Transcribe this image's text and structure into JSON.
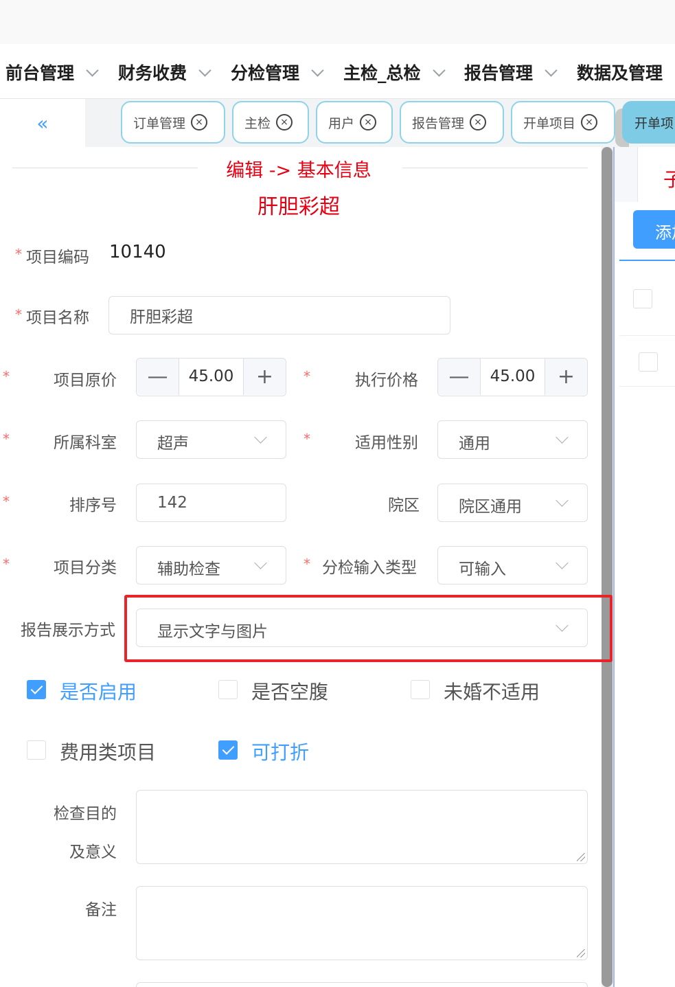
{
  "menu": [
    {
      "label": "前台管理"
    },
    {
      "label": "财务收费"
    },
    {
      "label": "分检管理"
    },
    {
      "label": "主检_总检"
    },
    {
      "label": "报告管理"
    },
    {
      "label": "数据及管理"
    }
  ],
  "tabs": [
    {
      "label": "订单管理"
    },
    {
      "label": "主检"
    },
    {
      "label": "用户"
    },
    {
      "label": "报告管理"
    },
    {
      "label": "开单项目"
    },
    {
      "label": "开单项"
    }
  ],
  "form": {
    "title": "编辑 -> 基本信息",
    "subtitle": "肝胆彩超",
    "code_label": "项目编码",
    "code_value": "10140",
    "name_label": "项目名称",
    "name_value": "肝胆彩超",
    "orig_price_label": "项目原价",
    "orig_price_value": "45.00",
    "exec_price_label": "执行价格",
    "exec_price_value": "45.00",
    "dept_label": "所属科室",
    "dept_value": "超声",
    "gender_label": "适用性别",
    "gender_value": "通用",
    "sort_label": "排序号",
    "sort_value": "142",
    "campus_label": "院区",
    "campus_value": "院区通用",
    "category_label": "项目分类",
    "category_value": "辅助检查",
    "input_type_label": "分检输入类型",
    "input_type_value": "可输入",
    "report_display_label": "报告展示方式",
    "report_display_value": "显示文字与图片",
    "purpose_label_1": "检查目的",
    "purpose_label_2": "及意义",
    "remark_label": "备注",
    "required_mark": "*",
    "minus": "—",
    "plus": "+"
  },
  "checkboxes": [
    {
      "label": "是否启用",
      "checked": true
    },
    {
      "label": "是否空腹",
      "checked": false
    },
    {
      "label": "未婚不适用",
      "checked": false
    },
    {
      "label": "费用类项目",
      "checked": false
    },
    {
      "label": "可打折",
      "checked": true
    }
  ],
  "right_panel": {
    "tab_text": "子",
    "button_label": "添加"
  },
  "icons": {
    "collapse": "«",
    "close": "×"
  },
  "colors": {
    "accent": "#409eff",
    "title_red": "#e60012",
    "highlight_red": "#e8232a",
    "tab_active": "#7ecbe6"
  }
}
